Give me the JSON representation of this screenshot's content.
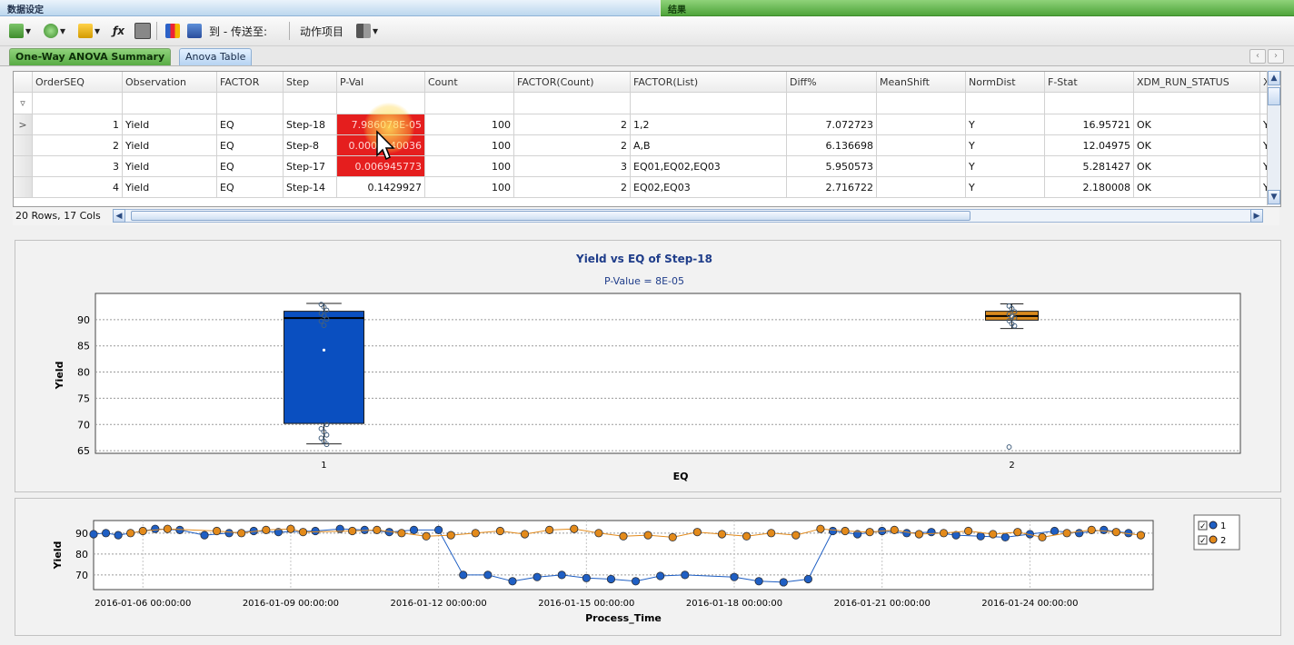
{
  "window": {
    "left_title": "数据设定",
    "right_title": "结果"
  },
  "toolbar": {
    "to_label": "到 - 传送至:",
    "action_label": "动作项目"
  },
  "tabs": [
    {
      "label": "One-Way ANOVA Summary",
      "active": true
    },
    {
      "label": "Anova Table",
      "active": false
    }
  ],
  "grid": {
    "columns": [
      "OrderSEQ",
      "Observation",
      "FACTOR",
      "Step",
      "P-Val",
      "Count",
      "FACTOR(Count)",
      "FACTOR(List)",
      "Diff%",
      "MeanShift",
      "NormDist",
      "F-Stat",
      "XDM_RUN_STATUS",
      "X"
    ],
    "rows": [
      {
        "indicator": ">",
        "cells": [
          "1",
          "Yield",
          "EQ",
          "Step-18",
          "7.986078E-05",
          "100",
          "2",
          "1,2",
          "7.072723",
          "",
          "Y",
          "16.95721",
          "OK",
          "Y"
        ],
        "red": true
      },
      {
        "indicator": "",
        "cells": [
          "2",
          "Yield",
          "EQ",
          "Step-8",
          "0.0007840036",
          "100",
          "2",
          "A,B",
          "6.136698",
          "",
          "Y",
          "12.04975",
          "OK",
          "Y"
        ],
        "red": true
      },
      {
        "indicator": "",
        "cells": [
          "3",
          "Yield",
          "EQ",
          "Step-17",
          "0.006945773",
          "100",
          "3",
          "EQ01,EQ02,EQ03",
          "5.950573",
          "",
          "Y",
          "5.281427",
          "OK",
          "Y"
        ],
        "red": true
      },
      {
        "indicator": "",
        "cells": [
          "4",
          "Yield",
          "EQ",
          "Step-14",
          "0.1429927",
          "100",
          "2",
          "EQ02,EQ03",
          "2.716722",
          "",
          "Y",
          "2.180008",
          "OK",
          "Y"
        ],
        "red": false
      }
    ],
    "status": "20 Rows, 17 Cols"
  },
  "chart_data": [
    {
      "type": "box",
      "title": "Yield vs EQ of Step-18",
      "subtitle": "P-Value = 8E-05",
      "xlabel": "EQ",
      "ylabel": "Yield",
      "ylim": [
        64.5,
        95
      ],
      "yticks": [
        65,
        70,
        75,
        80,
        85,
        90
      ],
      "categories": [
        "1",
        "2"
      ],
      "grid": true,
      "boxes": [
        {
          "category": "1",
          "color": "#0a4fc0",
          "min": 66.3,
          "q1": 70.2,
          "median": 90.3,
          "q3": 91.6,
          "max": 93.1,
          "mean": 84.2,
          "points": [
            92.9,
            92.4,
            91.8,
            91.2,
            90.8,
            90.1,
            89.7,
            88.9,
            70.0,
            69.2,
            68.6,
            68.0,
            67.4,
            66.8,
            66.2
          ]
        },
        {
          "category": "2",
          "color": "#d98a1e",
          "min": 88.3,
          "q1": 89.9,
          "median": 90.7,
          "q3": 91.6,
          "max": 93.0,
          "mean": 90.7,
          "points": [
            92.6,
            92.1,
            91.5,
            91.0,
            90.6,
            90.3,
            89.8,
            89.2,
            88.8,
            65.7
          ]
        }
      ]
    },
    {
      "type": "line",
      "xlabel": "Process_Time",
      "ylabel": "Yield",
      "ylim": [
        63,
        96
      ],
      "yticks": [
        70,
        80,
        90
      ],
      "xlim": [
        "2016-01-05 00:00:00",
        "2016-01-26 12:00:00"
      ],
      "xticks": [
        "2016-01-06 00:00:00",
        "2016-01-09 00:00:00",
        "2016-01-12 00:00:00",
        "2016-01-15 00:00:00",
        "2016-01-18 00:00:00",
        "2016-01-21 00:00:00",
        "2016-01-24 00:00:00"
      ],
      "legend_position": "right",
      "series": [
        {
          "name": "1",
          "color": "#1f5fc4",
          "x": [
            "2016-01-05 00:00:00",
            "2016-01-05 06:00:00",
            "2016-01-05 12:00:00",
            "2016-01-06 06:00:00",
            "2016-01-06 18:00:00",
            "2016-01-07 06:00:00",
            "2016-01-07 18:00:00",
            "2016-01-08 06:00:00",
            "2016-01-08 18:00:00",
            "2016-01-09 12:00:00",
            "2016-01-10 00:00:00",
            "2016-01-10 12:00:00",
            "2016-01-11 00:00:00",
            "2016-01-11 12:00:00",
            "2016-01-12 00:00:00",
            "2016-01-12 12:00:00",
            "2016-01-13 00:00:00",
            "2016-01-13 12:00:00",
            "2016-01-14 00:00:00",
            "2016-01-14 12:00:00",
            "2016-01-15 00:00:00",
            "2016-01-15 12:00:00",
            "2016-01-16 00:00:00",
            "2016-01-16 12:00:00",
            "2016-01-17 00:00:00",
            "2016-01-18 00:00:00",
            "2016-01-18 12:00:00",
            "2016-01-19 00:00:00",
            "2016-01-19 12:00:00",
            "2016-01-20 00:00:00",
            "2016-01-20 12:00:00",
            "2016-01-21 00:00:00",
            "2016-01-21 12:00:00",
            "2016-01-22 00:00:00",
            "2016-01-22 12:00:00",
            "2016-01-23 00:00:00",
            "2016-01-23 12:00:00",
            "2016-01-24 00:00:00",
            "2016-01-24 12:00:00",
            "2016-01-25 00:00:00",
            "2016-01-25 12:00:00",
            "2016-01-26 00:00:00"
          ],
          "y": [
            89.5,
            90.0,
            89.0,
            92.0,
            91.5,
            89.0,
            90.0,
            91.0,
            90.5,
            91.0,
            92.0,
            91.5,
            90.5,
            91.5,
            91.5,
            70.0,
            70.0,
            67.0,
            69.0,
            70.0,
            68.5,
            68.0,
            67.0,
            69.5,
            70.0,
            69.0,
            67.0,
            66.5,
            68.0,
            91.0,
            89.5,
            91.0,
            90.0,
            90.5,
            89.0,
            88.5,
            88.0,
            89.5,
            91.0,
            90.0,
            91.5,
            90.0
          ]
        },
        {
          "name": "2",
          "color": "#e38a1a",
          "x": [
            "2016-01-05 18:00:00",
            "2016-01-06 00:00:00",
            "2016-01-06 12:00:00",
            "2016-01-07 12:00:00",
            "2016-01-08 00:00:00",
            "2016-01-08 12:00:00",
            "2016-01-09 00:00:00",
            "2016-01-09 06:00:00",
            "2016-01-10 06:00:00",
            "2016-01-10 18:00:00",
            "2016-01-11 06:00:00",
            "2016-01-11 18:00:00",
            "2016-01-12 06:00:00",
            "2016-01-12 18:00:00",
            "2016-01-13 06:00:00",
            "2016-01-13 18:00:00",
            "2016-01-14 06:00:00",
            "2016-01-14 18:00:00",
            "2016-01-15 06:00:00",
            "2016-01-15 18:00:00",
            "2016-01-16 06:00:00",
            "2016-01-16 18:00:00",
            "2016-01-17 06:00:00",
            "2016-01-17 18:00:00",
            "2016-01-18 06:00:00",
            "2016-01-18 18:00:00",
            "2016-01-19 06:00:00",
            "2016-01-19 18:00:00",
            "2016-01-20 06:00:00",
            "2016-01-20 18:00:00",
            "2016-01-21 06:00:00",
            "2016-01-21 18:00:00",
            "2016-01-22 06:00:00",
            "2016-01-22 18:00:00",
            "2016-01-23 06:00:00",
            "2016-01-23 18:00:00",
            "2016-01-24 06:00:00",
            "2016-01-24 18:00:00",
            "2016-01-25 06:00:00",
            "2016-01-25 18:00:00",
            "2016-01-26 06:00:00"
          ],
          "y": [
            90.0,
            91.0,
            92.0,
            91.0,
            90.0,
            91.5,
            92.0,
            90.5,
            91.0,
            91.5,
            90.0,
            88.5,
            89.0,
            90.0,
            91.0,
            89.5,
            91.5,
            92.0,
            90.0,
            88.5,
            89.0,
            88.0,
            90.5,
            89.5,
            88.5,
            90.0,
            89.0,
            92.0,
            91.0,
            90.5,
            91.5,
            89.5,
            90.0,
            91.0,
            89.5,
            90.5,
            88.0,
            90.0,
            91.5,
            90.5,
            89.0
          ]
        }
      ]
    }
  ]
}
